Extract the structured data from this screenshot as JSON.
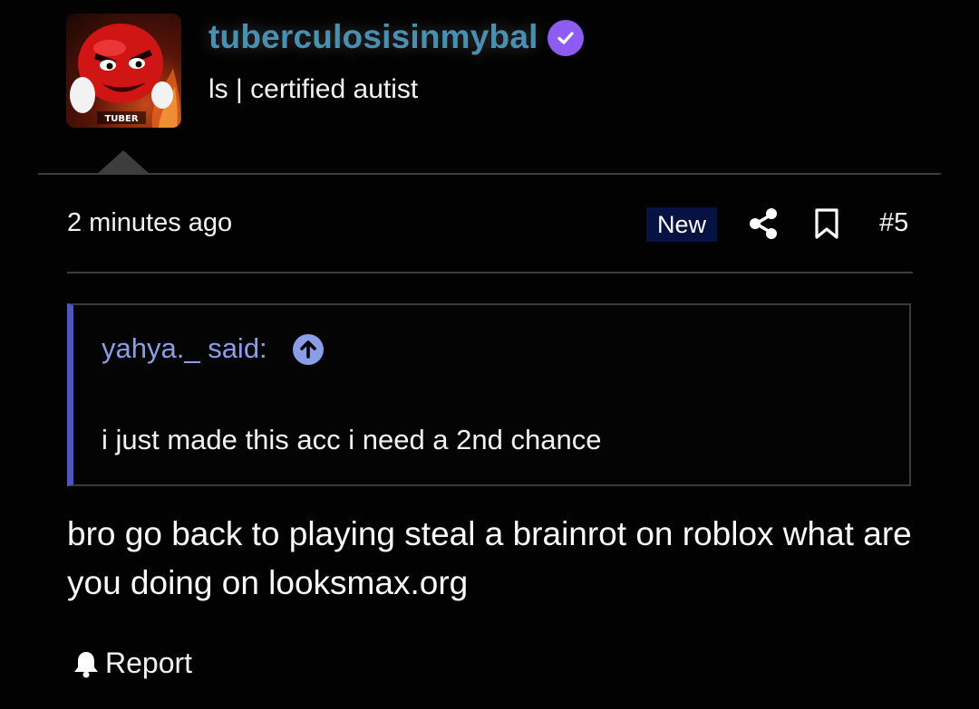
{
  "user": {
    "name": "tuberculosisinmybal",
    "title": "ls | certified autist",
    "avatar_caption": "TUBER",
    "verified_icon": "check-badge-icon"
  },
  "meta": {
    "time": "2 minutes ago",
    "badge": "New",
    "post_number": "#5",
    "share_icon": "share-icon",
    "bookmark_icon": "bookmark-icon"
  },
  "quote": {
    "author": "yahya._ said:",
    "text": "i just made this acc i need a 2nd chance",
    "jump_icon": "arrow-up-circle-icon"
  },
  "body": {
    "text": "bro go back to playing steal a brainrot on roblox what are you doing on looksmax.org"
  },
  "actions": {
    "report_label": "Report",
    "report_icon": "bell-icon"
  },
  "colors": {
    "background": "#020203",
    "username": "#4a8fb0",
    "verified": "#8e5cf0",
    "badge_bg": "#061242",
    "quote_accent": "#4e58b8",
    "quote_author": "#8a9ee8"
  }
}
